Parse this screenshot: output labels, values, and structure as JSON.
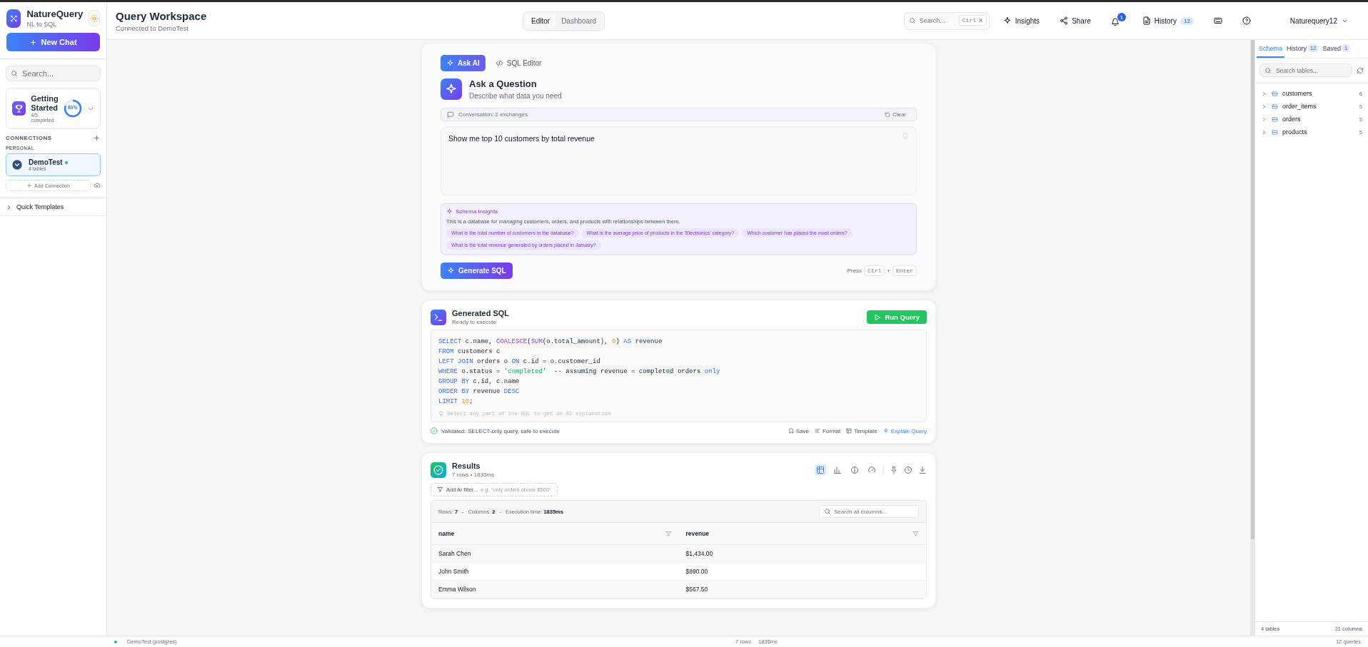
{
  "sidebar": {
    "brand": {
      "title": "NatureQuery",
      "subtitle": "NL to SQL"
    },
    "new_chat": "New Chat",
    "search": {
      "placeholder": "Search..."
    },
    "getting_started": {
      "title": "Getting Started",
      "progress": "4/5 completed",
      "percent": "80%",
      "level": 0.8,
      "expanded": false
    },
    "connections": {
      "heading": "CONNECTIONS",
      "group": "PERSONAL",
      "add": "Add Connection",
      "items": [
        {
          "name": "DemoTest",
          "detail": "4 tables",
          "selected": true,
          "online": true
        }
      ]
    },
    "quick_templates": {
      "label": "Quick Templates",
      "expanded": false
    }
  },
  "header": {
    "title": "Query Workspace",
    "subtitle": "Connected to DemoTest",
    "view_tabs": [
      {
        "label": "Editor",
        "selected": true
      },
      {
        "label": "Dashboard",
        "selected": false
      }
    ],
    "search": {
      "placeholder": "Search...",
      "shortcut": "Ctrl K"
    },
    "actions": [
      {
        "kind": "insights",
        "label": "Insights"
      },
      {
        "kind": "share",
        "label": "Share"
      },
      {
        "kind": "notifications",
        "badge": "1"
      },
      {
        "kind": "history",
        "label": "History",
        "badge": "12"
      },
      {
        "kind": "keyboard"
      },
      {
        "kind": "help"
      }
    ],
    "user": "Naturequery12"
  },
  "query_card": {
    "mode_tabs": [
      {
        "kind": "ai",
        "label": "Ask AI",
        "selected": true
      },
      {
        "kind": "sql",
        "label": "SQL Editor",
        "selected": false
      }
    ],
    "title": "Ask a Question",
    "subtitle": "Describe what data you need",
    "conversation": "Conversation: 2 exchanges",
    "clear": "Clear",
    "question": "Show me top 10 customers by total revenue",
    "insights": {
      "title": "Schema Insights",
      "description": "This is a database for managing customers, orders, and products with relationships between them.",
      "suggestions": [
        "What is the total number of customers in the database?",
        "What is the average price of products in the 'Electronics' category?",
        "Which customer has placed the most orders?",
        "What is the total revenue generated by orders placed in January?"
      ]
    },
    "generate": "Generate SQL",
    "hint": {
      "press": "Press",
      "keys": [
        "Ctrl",
        "Enter"
      ],
      "joiner": "+"
    }
  },
  "sql_card": {
    "title": "Generated SQL",
    "subtitle": "Ready to execute",
    "run": "Run Query",
    "lines": [
      [
        {
          "t": "SELECT",
          "kind": "kw"
        },
        {
          "t": " c.name, ",
          "kind": "txt"
        },
        {
          "t": "COALESCE",
          "kind": "fn"
        },
        {
          "t": "(",
          "kind": "txt"
        },
        {
          "t": "SUM",
          "kind": "fn"
        },
        {
          "t": "(o.total_amount), ",
          "kind": "txt"
        },
        {
          "t": "0",
          "kind": "num"
        },
        {
          "t": ") ",
          "kind": "txt"
        },
        {
          "t": "AS",
          "kind": "kw"
        },
        {
          "t": " revenue",
          "kind": "txt"
        }
      ],
      [
        {
          "t": "FROM",
          "kind": "kw"
        },
        {
          "t": " customers c",
          "kind": "txt"
        }
      ],
      [
        {
          "t": "LEFT JOIN",
          "kind": "kw"
        },
        {
          "t": " orders o ",
          "kind": "txt"
        },
        {
          "t": "ON",
          "kind": "kw"
        },
        {
          "t": " c.id = o.customer_id",
          "kind": "txt"
        }
      ],
      [
        {
          "t": "WHERE",
          "kind": "kw"
        },
        {
          "t": " o.status = ",
          "kind": "txt"
        },
        {
          "t": "'completed'",
          "kind": "str"
        },
        {
          "t": "  -- assuming revenue = completed orders ",
          "kind": "txt"
        },
        {
          "t": "only",
          "kind": "kw"
        }
      ],
      [
        {
          "t": "GROUP BY",
          "kind": "kw"
        },
        {
          "t": " c.id, c.name",
          "kind": "txt"
        }
      ],
      [
        {
          "t": "ORDER BY",
          "kind": "kw"
        },
        {
          "t": " revenue ",
          "kind": "txt"
        },
        {
          "t": "DESC",
          "kind": "kw"
        }
      ],
      [
        {
          "t": "LIMIT",
          "kind": "kw"
        },
        {
          "t": " 10",
          "kind": "num"
        },
        {
          "t": ";",
          "kind": "txt"
        }
      ]
    ],
    "tip": "Select any part of the SQL to get an AI explanation",
    "validation": "Validated: SELECT-only query, safe to execute",
    "actions": [
      {
        "kind": "save",
        "label": "Save"
      },
      {
        "kind": "format",
        "label": "Format"
      },
      {
        "kind": "template",
        "label": "Template"
      },
      {
        "kind": "explain",
        "label": "Explain Query"
      }
    ]
  },
  "results": {
    "title": "Results",
    "subtitle": "7 rows • 1835ms",
    "views": [
      {
        "kind": "table",
        "selected": true
      },
      {
        "kind": "chart",
        "selected": false
      },
      {
        "kind": "pie",
        "selected": false
      },
      {
        "kind": "gauge",
        "selected": false
      }
    ],
    "ai_filter": {
      "label": "Add AI filter...",
      "placeholder": "e.g. \"only orders above $500\""
    },
    "stats": [
      {
        "label": "Rows:",
        "value": "7"
      },
      {
        "separator": "-",
        "label": "Columns:",
        "value": "2"
      },
      {
        "separator": "-",
        "label": "Execution time:",
        "value": "1835ms"
      }
    ],
    "search": {
      "placeholder": "Search all columns..."
    },
    "table": {
      "columns": [
        "name",
        "revenue"
      ],
      "rows": [
        [
          "Sarah Chen",
          "$1,434.00"
        ],
        [
          "John Smith",
          "$890.00"
        ],
        [
          "Emma Wilson",
          "$567.50"
        ]
      ]
    }
  },
  "schema_panel": {
    "tabs": [
      {
        "label": "Schema",
        "selected": true
      },
      {
        "label": "History",
        "badge": "12",
        "selected": false
      },
      {
        "label": "Saved",
        "badge": "1",
        "selected": false
      }
    ],
    "search": {
      "placeholder": "Search tables..."
    },
    "tables": [
      {
        "name": "customers",
        "count": "6",
        "expanded": false
      },
      {
        "name": "order_items",
        "count": "5",
        "expanded": false
      },
      {
        "name": "orders",
        "count": "5",
        "expanded": false
      },
      {
        "name": "products",
        "count": "5",
        "expanded": false
      }
    ],
    "footer": {
      "tables": "4 tables",
      "columns": "21 columns"
    }
  },
  "status_bar": {
    "connection": "DemoTest (postgres)",
    "rows": "7 rows",
    "time": "1835ms",
    "queries": "12 queries"
  }
}
